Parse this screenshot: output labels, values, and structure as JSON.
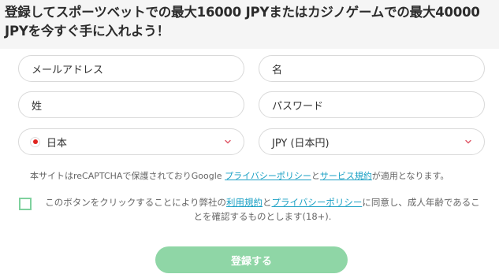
{
  "header": {
    "title": "登録してスポーツベットでの最大16000 JPYまたはカジノゲームでの最大40000 JPYを今すぐ手に入れよう！"
  },
  "form": {
    "email_placeholder": "メールアドレス",
    "first_name_placeholder": "名",
    "last_name_placeholder": "姓",
    "password_placeholder": "パスワード",
    "country_value": "日本",
    "currency_value": "JPY (日本円)",
    "recaptcha_prefix": "本サイトはreCAPTCHAで保護されておりGoogle ",
    "recaptcha_privacy_link": "プライバシーポリシー",
    "recaptcha_and": "と",
    "recaptcha_terms_link": "サービス規約",
    "recaptcha_suffix": "が適用となります。",
    "consent_prefix": "このボタンをクリックすることにより弊社の",
    "consent_terms_link": "利用規約",
    "consent_and": "と",
    "consent_privacy_link": "プライバシーポリシー",
    "consent_suffix": "に同意し、成人年齢であることを確認するものとします(18+).",
    "submit_label": "登録する"
  },
  "colors": {
    "accent_green": "#8fd6a6",
    "link": "#1aa0c4",
    "flag_red": "#e0241f"
  },
  "icons": {
    "country_flag": "japan-flag-icon",
    "dropdown": "chevron-down-icon"
  }
}
